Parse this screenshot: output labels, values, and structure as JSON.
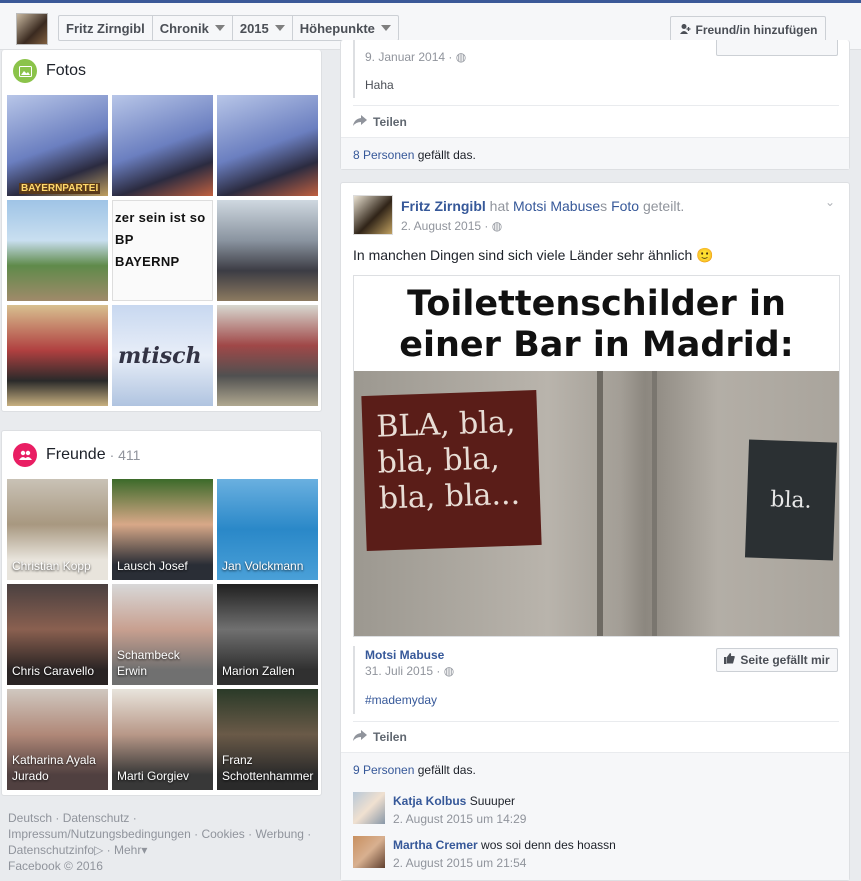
{
  "header": {
    "crumbs": [
      "Fritz Zirngibl",
      "Chronik",
      "2015",
      "Höhepunkte"
    ],
    "add_friend_label": "Freund/in hinzufügen"
  },
  "photos": {
    "title": "Fotos",
    "tiles": [
      {
        "text": "BAYERNPARTEI"
      },
      {
        "text": ""
      },
      {
        "text": ""
      },
      {
        "text": ""
      },
      {
        "text": "zer sein ist so\nBP\nBAYERNP"
      },
      {
        "text": ""
      },
      {
        "text": ""
      },
      {
        "text": "mtisch"
      },
      {
        "text": ""
      }
    ]
  },
  "friends": {
    "title": "Freunde",
    "count": "· 411",
    "items": [
      {
        "name": "Christian Kopp"
      },
      {
        "name": "Lausch Josef"
      },
      {
        "name": "Jan Volckmann"
      },
      {
        "name": "Chris Caravello"
      },
      {
        "name": "Schambeck Erwin"
      },
      {
        "name": "Marion Zallen"
      },
      {
        "name": "Katharina Ayala Jurado"
      },
      {
        "name": "Marti Gorgiev"
      },
      {
        "name": "Franz Schottenhammer"
      }
    ]
  },
  "footer": {
    "links": [
      "Deutsch",
      "Datenschutz",
      "Impressum/Nutzungsbedingungen",
      "Cookies",
      "Werbung",
      "Datenschutzinfo",
      "Mehr"
    ],
    "copyright": "Facebook © 2016"
  },
  "post1": {
    "date": "9. Januar 2014 ·",
    "comment_text": "Haha",
    "share_label": "Teilen",
    "likes_count": "8 Personen",
    "likes_suffix": "gefällt das."
  },
  "post2": {
    "author": "Fritz Zirngibl",
    "verb1": "hat",
    "shared_from": "Motsi Mabuse",
    "verb2": "s",
    "object": "Foto",
    "verb3": "geteilt.",
    "date": "2. August 2015 ·",
    "text": "In manchen Dingen sind sich viele Länder sehr ähnlich 🙂",
    "image": {
      "headline": "Toilettenschilder in einer Bar in Madrid:",
      "sign_left": "BLA, bla, bla, bla, bla, bla...",
      "sign_right": "bla."
    },
    "source": {
      "name": "Motsi Mabuse",
      "date": "31. Juli 2015 ·",
      "hashtag": "#mademyday",
      "like_page_label": "Seite gefällt mir"
    },
    "share_label": "Teilen",
    "likes_count": "9 Personen",
    "likes_suffix": "gefällt das.",
    "comments": [
      {
        "author": "Katja Kolbus",
        "text": "Suuuper",
        "time": "2. August 2015 um 14:29"
      },
      {
        "author": "Martha Cremer",
        "text": "wos soi denn des hoassn",
        "time": "2. August 2015 um 21:54"
      }
    ]
  }
}
